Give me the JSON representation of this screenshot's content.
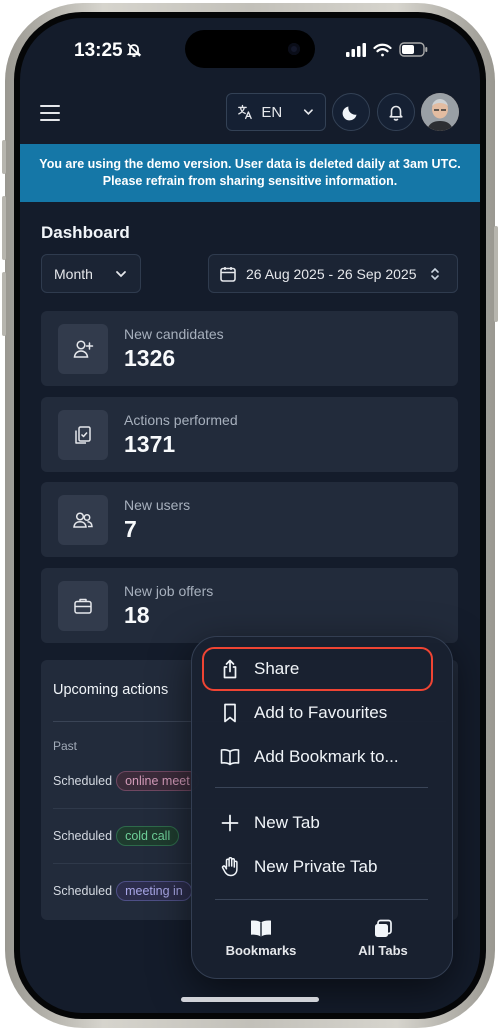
{
  "status_bar": {
    "time": "13:25"
  },
  "header": {
    "language": "EN"
  },
  "banner": {
    "line1": "You are using the demo version. User data is deleted daily at 3am UTC.",
    "line2": "Please refrain from sharing sensitive information."
  },
  "dashboard": {
    "title": "Dashboard",
    "period": "Month",
    "date_range": "26 Aug 2025 - 26 Sep 2025",
    "stats": [
      {
        "label": "New candidates",
        "value": "1326",
        "icon": "add-user-icon"
      },
      {
        "label": "Actions performed",
        "value": "1371",
        "icon": "clipboard-check-icon"
      },
      {
        "label": "New users",
        "value": "7",
        "icon": "users-icon"
      },
      {
        "label": "New job offers",
        "value": "18",
        "icon": "briefcase-icon"
      }
    ]
  },
  "upcoming_actions": {
    "title": "Upcoming actions",
    "past_label": "Past",
    "rows": [
      {
        "status": "Scheduled",
        "tag": "online meet",
        "tag_color": "#d29ab8"
      },
      {
        "status": "Scheduled",
        "tag": "cold call",
        "tag_color": "#6ecf98"
      },
      {
        "status": "Scheduled",
        "tag": "meeting in",
        "tag_color": "#a8a6e6"
      }
    ]
  },
  "share_menu": {
    "items": [
      {
        "label": "Share",
        "icon": "share-icon"
      },
      {
        "label": "Add to Favourites",
        "icon": "bookmark-icon"
      },
      {
        "label": "Add Bookmark to...",
        "icon": "book-open-icon"
      },
      {
        "label": "New Tab",
        "icon": "plus-icon"
      },
      {
        "label": "New Private Tab",
        "icon": "hand-icon"
      }
    ],
    "tabs": [
      {
        "label": "Bookmarks",
        "icon": "book-icon"
      },
      {
        "label": "All Tabs",
        "icon": "tabs-icon"
      }
    ],
    "highlight_color": "#ef4433"
  }
}
